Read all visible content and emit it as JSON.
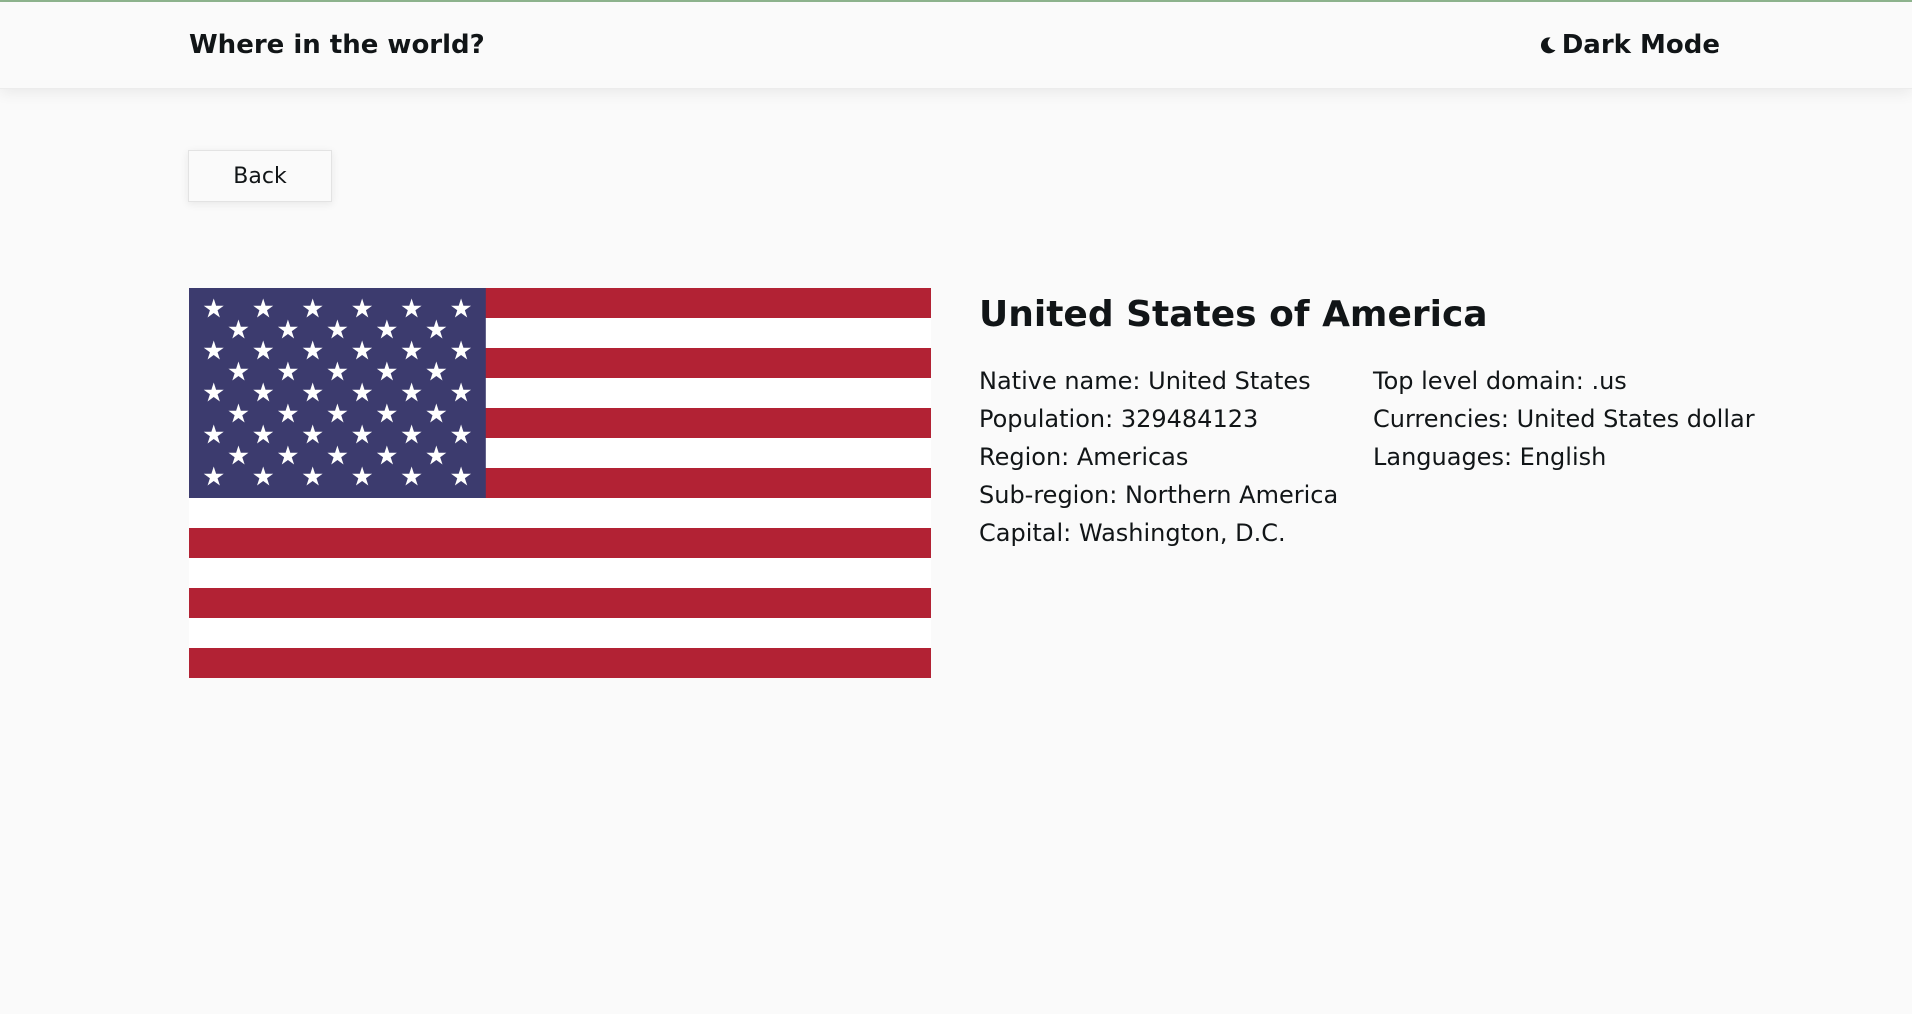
{
  "header": {
    "title": "Where in the world?",
    "mode_toggle_label": "Dark Mode",
    "mode_toggle_icon": "moon-icon"
  },
  "back_button": {
    "label": "Back"
  },
  "country": {
    "name": "United States of America",
    "flag": {
      "stripe_red": "#b22234",
      "stripe_white": "#ffffff",
      "canton_blue": "#3c3b6e"
    },
    "left": [
      {
        "label": "Native name:",
        "value": "United States"
      },
      {
        "label": "Population:",
        "value": "329484123"
      },
      {
        "label": "Region:",
        "value": "Americas"
      },
      {
        "label": "Sub-region:",
        "value": "Northern America"
      },
      {
        "label": "Capital:",
        "value": "Washington, D.C."
      }
    ],
    "right": [
      {
        "label": "Top level domain:",
        "value": ".us"
      },
      {
        "label": "Currencies:",
        "value": "United States dollar"
      },
      {
        "label": "Languages:",
        "value": "English"
      }
    ]
  }
}
